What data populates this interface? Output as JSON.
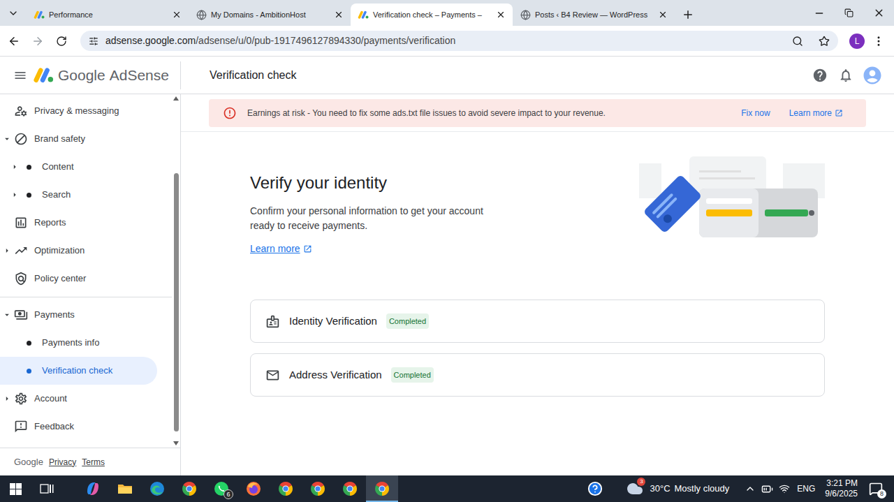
{
  "browser": {
    "tabs": [
      {
        "title": "Performance",
        "selected": false,
        "favicon": "adsense"
      },
      {
        "title": "My Domains - AmbitionHost",
        "selected": false,
        "favicon": "globe"
      },
      {
        "title": "Verification check – Payments –",
        "selected": true,
        "favicon": "adsense"
      },
      {
        "title": "Posts ‹ B4 Review — WordPress",
        "selected": false,
        "favicon": "globe"
      }
    ],
    "address": {
      "host": "adsense.google.com",
      "path": "/adsense/u/0/pub-1917496127894330/payments/verification"
    },
    "profile": "L"
  },
  "app": {
    "logo_google": "Google",
    "logo_product": "AdSense",
    "page_title": "Verification check"
  },
  "alert": {
    "text": "Earnings at risk - You need to fix some ads.txt file issues to avoid severe impact to your revenue.",
    "action": "Fix now",
    "link": "Learn more"
  },
  "sidebar": {
    "groups": [
      [
        {
          "label": "Privacy & messaging",
          "level": 0,
          "expandable": false,
          "expanded": false,
          "selected": false
        },
        {
          "label": "Brand safety",
          "level": 0,
          "expandable": true,
          "expanded": true,
          "selected": false
        },
        {
          "label": "Content",
          "level": 1,
          "expandable": true,
          "expanded": false,
          "selected": false
        },
        {
          "label": "Search",
          "level": 1,
          "expandable": true,
          "expanded": false,
          "selected": false
        },
        {
          "label": "Reports",
          "level": 0,
          "expandable": false,
          "expanded": false,
          "selected": false
        },
        {
          "label": "Optimization",
          "level": 0,
          "expandable": true,
          "expanded": false,
          "selected": false
        },
        {
          "label": "Policy center",
          "level": 0,
          "expandable": false,
          "expanded": false,
          "selected": false
        }
      ],
      [
        {
          "label": "Payments",
          "level": 0,
          "expandable": true,
          "expanded": true,
          "selected": false
        },
        {
          "label": "Payments info",
          "level": 1,
          "expandable": false,
          "expanded": false,
          "selected": false
        },
        {
          "label": "Verification check",
          "level": 1,
          "expandable": false,
          "expanded": false,
          "selected": true
        },
        {
          "label": "Account",
          "level": 0,
          "expandable": true,
          "expanded": false,
          "selected": false
        },
        {
          "label": "Feedback",
          "level": 0,
          "expandable": false,
          "expanded": false,
          "selected": false
        }
      ]
    ],
    "footer": [
      "Google",
      "Privacy",
      "Terms"
    ]
  },
  "main": {
    "heading": "Verify your identity",
    "description": "Confirm your personal information to get your account ready to receive payments.",
    "link": "Learn more",
    "checks": [
      {
        "label": "Identity Verification",
        "status": "Completed"
      },
      {
        "label": "Address Verification",
        "status": "Completed"
      }
    ]
  },
  "taskbar": {
    "apps": [
      {
        "active": false
      },
      {
        "active": false
      },
      {
        "active": false
      },
      {
        "active": false
      },
      {
        "active": false,
        "badge": "6"
      },
      {
        "active": false
      },
      {
        "active": false
      },
      {
        "active": false
      },
      {
        "active": false
      },
      {
        "active": true
      }
    ],
    "weather": {
      "badge": "3",
      "temp": "30°C",
      "condition": "Mostly cloudy"
    },
    "language": "ENG",
    "time": "3:21 PM",
    "date": "9/6/2025",
    "notifications": "8"
  }
}
